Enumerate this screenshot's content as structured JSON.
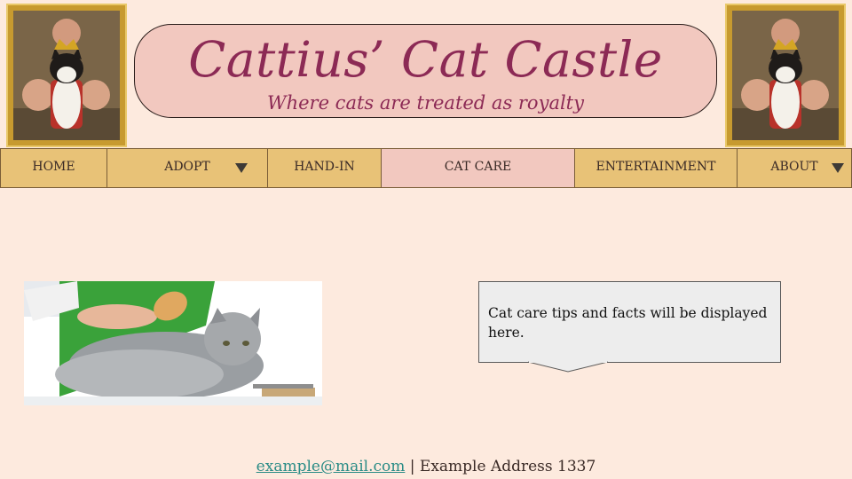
{
  "header": {
    "title": "Cattius’ Cat Castle",
    "tagline": "Where cats are treated as royalty"
  },
  "nav": {
    "items": [
      {
        "label": "HOME",
        "dropdown": false
      },
      {
        "label": "ADOPT",
        "dropdown": true
      },
      {
        "label": "HAND-IN",
        "dropdown": false
      },
      {
        "label": "CAT CARE",
        "dropdown": false,
        "active": true
      },
      {
        "label": "ENTERTAINMENT",
        "dropdown": false
      },
      {
        "label": "ABOUT",
        "dropdown": true
      }
    ]
  },
  "main": {
    "info_text": "Cat care tips and facts will be displayed here."
  },
  "footer": {
    "email": "example@mail.com",
    "separator": "|",
    "address": "Example Address 1337"
  },
  "colors": {
    "background": "#fdeade",
    "nav": "#e8c277",
    "nav_active": "#f2c8bf",
    "title": "#8c2a55",
    "link": "#2a8c86"
  }
}
